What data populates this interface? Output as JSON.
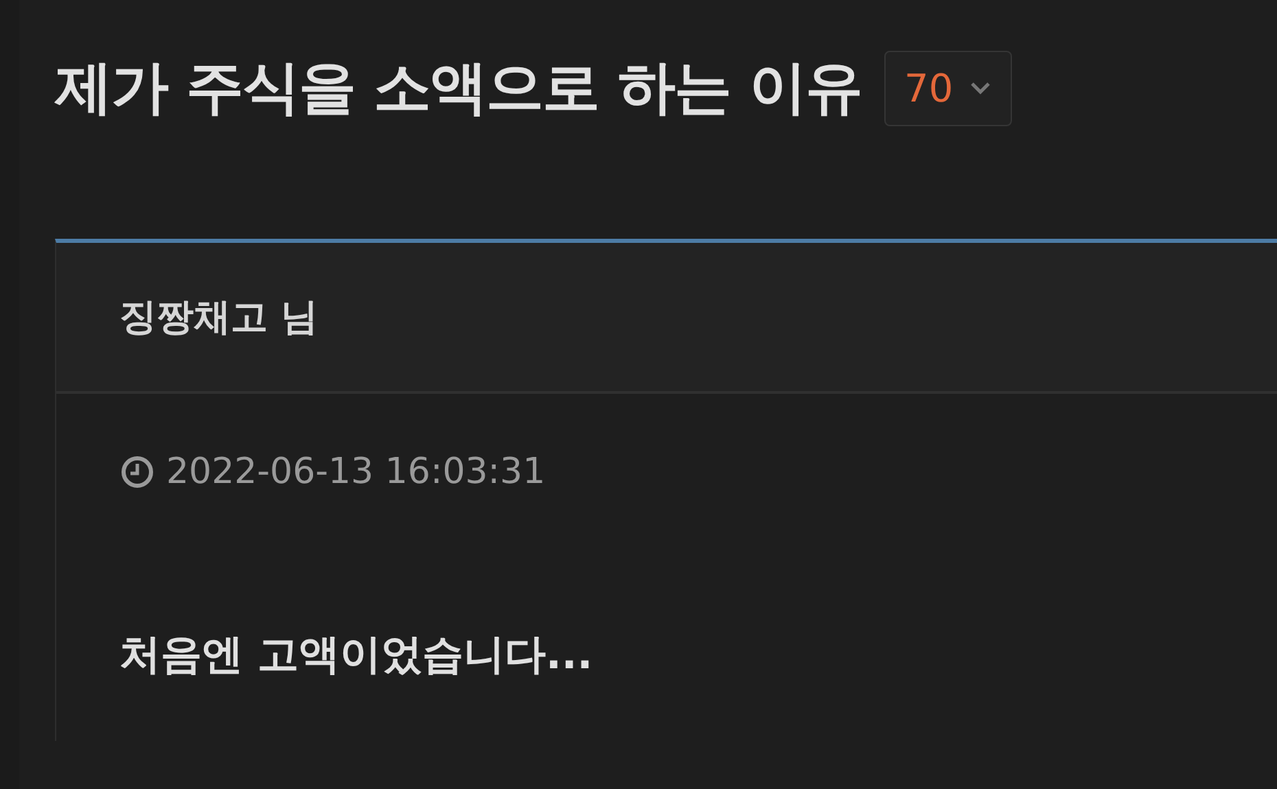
{
  "title": "제가 주식을 소액으로 하는 이유",
  "vote_badge": {
    "count": "70"
  },
  "post": {
    "author": "징짱채고 님",
    "timestamp": "2022-06-13 16:03:31",
    "body": "처음엔 고액이었습니다..."
  }
}
